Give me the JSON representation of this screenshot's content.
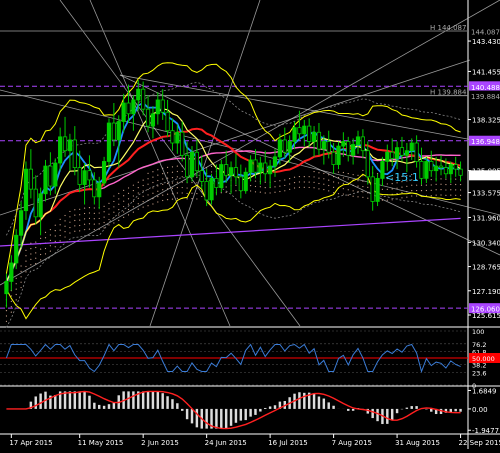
{
  "chart_data": {
    "type": "candlestick",
    "symbol_tag": "<15:1",
    "price_axis": {
      "ylim": [
        124.9,
        146.1
      ],
      "tick_labels": [
        "143.430",
        "141.455",
        "138.325",
        "135.005",
        "133.575",
        "131.960",
        "130.340",
        "128.765",
        "127.190",
        "125.615"
      ],
      "tick_values": [
        143.43,
        141.455,
        138.325,
        135.005,
        133.575,
        131.96,
        130.34,
        128.765,
        127.19,
        125.615
      ]
    },
    "levels": [
      {
        "label": "144.087",
        "value": 144.087,
        "color": "#777777",
        "style": "solid",
        "tag": "H"
      },
      {
        "label": "140.488",
        "value": 140.488,
        "color": "#aa44ff",
        "style": "dash"
      },
      {
        "label": "139.884",
        "value": 139.884,
        "color": "#999999",
        "style": "solid",
        "tag": "H"
      },
      {
        "label": "136.948",
        "value": 136.948,
        "color": "#aa44ff",
        "style": "dash"
      },
      {
        "label": "126.060",
        "value": 126.06,
        "color": "#aa44ff",
        "style": "dash"
      }
    ],
    "x_axis": {
      "labels": [
        "17 Apr 2015",
        "11 May 2015",
        "2 Jun 2015",
        "24 Jun 2015",
        "16 Jul 2015",
        "7 Aug 2015",
        "31 Aug 2015",
        "22 Sep 2015"
      ],
      "label_bars": [
        1,
        15,
        28,
        41,
        54,
        67,
        80,
        93
      ]
    },
    "candles": [
      [
        127.0,
        128.3,
        126.1,
        127.8
      ],
      [
        127.8,
        129.5,
        127.2,
        129.0
      ],
      [
        129.0,
        131.2,
        128.6,
        130.8
      ],
      [
        130.8,
        133.0,
        130.0,
        132.4
      ],
      [
        132.4,
        135.6,
        131.8,
        135.1
      ],
      [
        135.1,
        136.4,
        133.2,
        133.8
      ],
      [
        133.8,
        134.7,
        131.5,
        132.0
      ],
      [
        132.0,
        133.9,
        130.8,
        133.5
      ],
      [
        133.5,
        135.7,
        133.0,
        135.3
      ],
      [
        135.3,
        136.2,
        133.4,
        134.0
      ],
      [
        134.0,
        135.8,
        133.5,
        135.5
      ],
      [
        135.5,
        137.8,
        135.0,
        137.2
      ],
      [
        137.2,
        138.5,
        135.9,
        136.3
      ],
      [
        136.3,
        137.4,
        135.0,
        137.0
      ],
      [
        137.0,
        137.9,
        134.7,
        135.2
      ],
      [
        135.2,
        136.3,
        133.6,
        134.1
      ],
      [
        134.1,
        135.5,
        132.8,
        135.0
      ],
      [
        135.0,
        136.0,
        133.9,
        134.4
      ],
      [
        134.4,
        134.9,
        132.8,
        133.3
      ],
      [
        133.3,
        134.6,
        132.5,
        134.2
      ],
      [
        134.2,
        135.9,
        134.0,
        135.6
      ],
      [
        135.6,
        138.4,
        135.2,
        138.1
      ],
      [
        138.1,
        139.4,
        136.6,
        137.0
      ],
      [
        137.0,
        138.6,
        135.2,
        138.2
      ],
      [
        138.2,
        140.0,
        137.5,
        139.4
      ],
      [
        139.4,
        140.6,
        138.1,
        138.7
      ],
      [
        138.7,
        139.9,
        137.6,
        139.6
      ],
      [
        139.6,
        140.9,
        138.9,
        140.3
      ],
      [
        140.3,
        140.8,
        138.6,
        139.0
      ],
      [
        139.0,
        139.9,
        137.5,
        137.9
      ],
      [
        137.9,
        139.2,
        137.1,
        138.7
      ],
      [
        138.7,
        140.1,
        138.0,
        139.6
      ],
      [
        139.6,
        140.3,
        138.3,
        138.8
      ],
      [
        138.8,
        139.6,
        137.2,
        137.6
      ],
      [
        137.6,
        138.4,
        136.3,
        136.8
      ],
      [
        136.8,
        138.0,
        136.1,
        137.5
      ],
      [
        137.5,
        138.2,
        135.6,
        136.0
      ],
      [
        136.0,
        136.9,
        134.2,
        134.6
      ],
      [
        134.6,
        136.6,
        134.3,
        136.2
      ],
      [
        136.2,
        137.0,
        134.6,
        135.0
      ],
      [
        135.0,
        136.0,
        133.8,
        134.3
      ],
      [
        134.3,
        135.1,
        132.7,
        133.1
      ],
      [
        133.1,
        134.8,
        132.8,
        134.5
      ],
      [
        134.5,
        135.4,
        133.4,
        133.9
      ],
      [
        133.9,
        135.7,
        133.6,
        135.4
      ],
      [
        135.4,
        136.3,
        134.2,
        134.7
      ],
      [
        134.7,
        135.6,
        133.5,
        135.2
      ],
      [
        135.2,
        136.1,
        134.1,
        134.6
      ],
      [
        134.6,
        135.4,
        133.2,
        133.7
      ],
      [
        133.7,
        135.2,
        133.5,
        134.9
      ],
      [
        134.9,
        136.0,
        134.3,
        135.7
      ],
      [
        135.7,
        136.4,
        134.5,
        134.9
      ],
      [
        134.9,
        135.9,
        134.1,
        135.5
      ],
      [
        135.5,
        136.3,
        134.3,
        134.8
      ],
      [
        134.8,
        135.7,
        133.9,
        135.3
      ],
      [
        135.3,
        136.4,
        134.6,
        135.9
      ],
      [
        135.9,
        137.4,
        135.4,
        137.0
      ],
      [
        137.0,
        137.8,
        135.8,
        136.2
      ],
      [
        136.2,
        137.3,
        135.5,
        136.9
      ],
      [
        136.9,
        138.2,
        136.4,
        137.8
      ],
      [
        137.8,
        138.9,
        137.0,
        137.4
      ],
      [
        137.4,
        138.3,
        136.6,
        137.9
      ],
      [
        137.9,
        138.4,
        136.5,
        136.9
      ],
      [
        136.9,
        137.9,
        135.9,
        137.5
      ],
      [
        137.5,
        138.1,
        136.0,
        136.4
      ],
      [
        136.4,
        137.3,
        135.4,
        136.9
      ],
      [
        136.9,
        137.6,
        135.8,
        136.2
      ],
      [
        136.2,
        136.8,
        134.8,
        135.4
      ],
      [
        135.4,
        136.9,
        135.1,
        136.6
      ],
      [
        136.6,
        137.5,
        135.9,
        136.9
      ],
      [
        136.9,
        137.2,
        135.6,
        136.0
      ],
      [
        136.0,
        137.1,
        135.4,
        136.7
      ],
      [
        136.7,
        137.6,
        136.1,
        137.2
      ],
      [
        137.2,
        137.7,
        135.8,
        136.3
      ],
      [
        136.3,
        136.9,
        134.1,
        134.6
      ],
      [
        134.6,
        135.3,
        132.4,
        133.0
      ],
      [
        133.0,
        134.8,
        132.7,
        134.5
      ],
      [
        134.5,
        135.9,
        134.0,
        135.6
      ],
      [
        135.6,
        136.7,
        135.0,
        136.2
      ],
      [
        136.2,
        137.1,
        135.3,
        135.8
      ],
      [
        135.8,
        136.9,
        135.1,
        136.5
      ],
      [
        136.5,
        137.2,
        135.6,
        136.0
      ],
      [
        136.0,
        136.8,
        134.9,
        136.3
      ],
      [
        136.3,
        137.1,
        135.7,
        136.8
      ],
      [
        136.8,
        137.3,
        135.2,
        135.6
      ],
      [
        135.6,
        136.5,
        134.1,
        134.5
      ],
      [
        134.5,
        135.9,
        134.2,
        135.6
      ],
      [
        135.6,
        136.3,
        134.6,
        135.0
      ],
      [
        135.0,
        135.9,
        134.3,
        135.3
      ],
      [
        135.3,
        136.0,
        134.7,
        135.2
      ],
      [
        135.2,
        135.8,
        134.5,
        134.8
      ],
      [
        134.8,
        135.6,
        134.2,
        135.4
      ],
      [
        135.4,
        135.9,
        134.6,
        135.1
      ],
      [
        135.1,
        135.6,
        134.3,
        134.7
      ]
    ],
    "stochastic_panel": {
      "ylim": [
        0,
        100
      ],
      "tick_labels": [
        "100",
        "76.2",
        "61.8",
        "50.000",
        "38.2",
        "23.6",
        "0"
      ],
      "tick_values": [
        100,
        76.2,
        61.8,
        50,
        38.2,
        23.6,
        0
      ],
      "highlight": {
        "label": "50.000",
        "value": 50,
        "color": "#ff0000"
      }
    },
    "macd_panel": {
      "ylim": [
        -2.2,
        2.0
      ],
      "tick_labels": [
        "1.6849",
        "0.00",
        "-1.9477"
      ],
      "tick_values": [
        1.6849,
        0,
        -1.9477
      ]
    },
    "colors": {
      "bull": "#00cc00",
      "bear": "#00cc00",
      "ma_fast": "#1e90ff",
      "ma_slow": "#ff2020",
      "bollinger": "#ffff00",
      "cloud": "#c8a08a",
      "kijun": "#ff66cc",
      "trendline": "#aa44ff",
      "fan": "#cccccc",
      "osc": "#3a7bd5",
      "macd_line": "#ff2020",
      "macd_hist": "#dddddd"
    }
  }
}
